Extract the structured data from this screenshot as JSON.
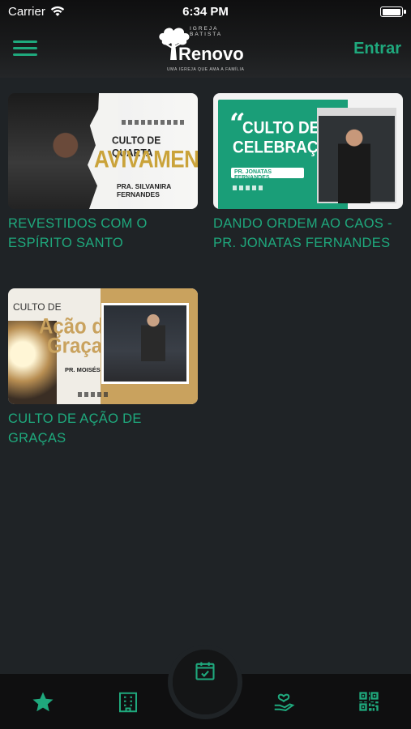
{
  "status_bar": {
    "carrier": "Carrier",
    "time": "6:34 PM",
    "battery_level": 1.0
  },
  "header": {
    "menu_icon": "hamburger-icon",
    "logo": {
      "small_text": "IGREJA BATISTA",
      "brand": "Renovo",
      "tagline": "UMA IGREJA QUE AMA A FAMÍLIA"
    },
    "login_label": "Entrar"
  },
  "colors": {
    "accent": "#1fa97d",
    "background": "#1f2326",
    "header_bg": "#111213",
    "tabbar_bg": "#0f0f10"
  },
  "videos": [
    {
      "title": "REVESTIDOS COM O ESPÍRITO SANTO",
      "thumb": {
        "line1": "CULTO DE QUARTA",
        "line2": "AVIVAMENTO",
        "line3": "PRA. SILVANIRA FERNANDES"
      }
    },
    {
      "title": "DANDO ORDEM AO CAOS - PR. JONATAS FERNANDES",
      "thumb": {
        "line1": "CULTO DE",
        "line2": "CELEBRAÇÃO",
        "line3": "PR. JONATAS FERNANDES"
      }
    },
    {
      "title": "CULTO DE AÇÃO DE GRAÇAS",
      "thumb": {
        "line0": "CULTO DE",
        "line1": "Ação de",
        "line2": "Graças",
        "line3": "PR. MOISÉS FERNANDES"
      }
    }
  ],
  "tabbar": {
    "items": [
      {
        "icon": "star-icon"
      },
      {
        "icon": "building-icon"
      },
      {
        "icon": "calendar-check-icon",
        "active": true
      },
      {
        "icon": "heart-hand-icon"
      },
      {
        "icon": "qr-code-icon"
      }
    ]
  }
}
